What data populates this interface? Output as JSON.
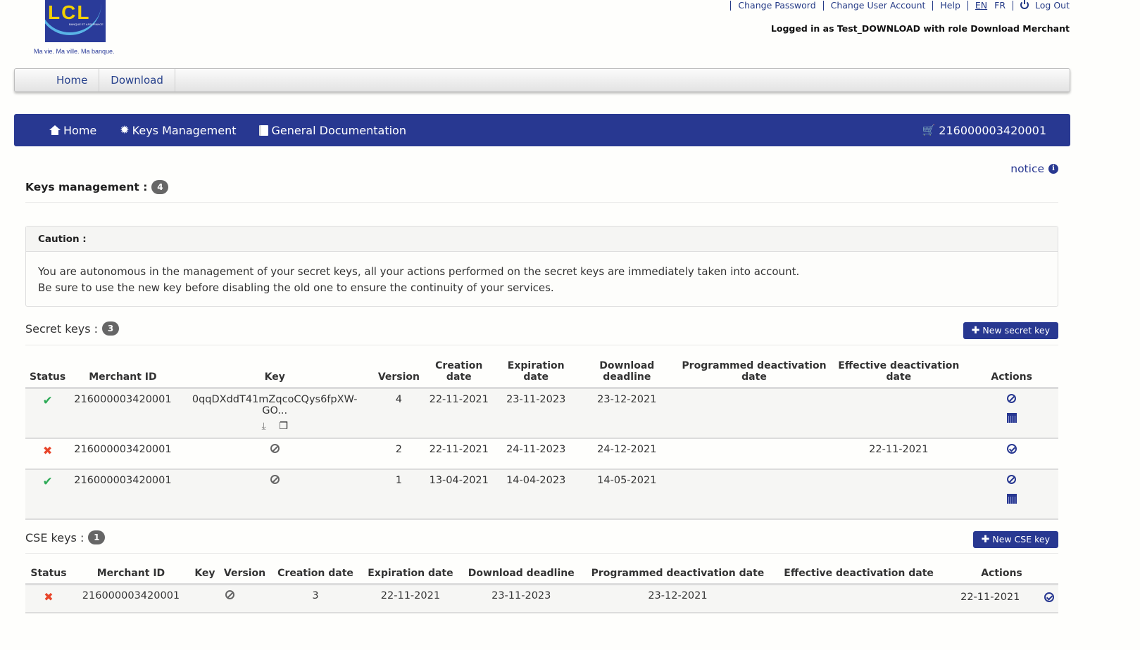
{
  "logo": {
    "brand": "LCL",
    "subtitle": "BANQUE ET ASSURANCE",
    "tagline": "Ma vie. Ma ville. Ma banque."
  },
  "toplinks": {
    "change_password": "Change Password",
    "change_user_account": "Change User Account",
    "help": "Help",
    "lang_en": "EN",
    "lang_fr": "FR",
    "logout": "Log Out"
  },
  "logged_in": "Logged in as Test_DOWNLOAD with role Download Merchant",
  "graynav": {
    "items": [
      "Home",
      "Download"
    ]
  },
  "bluenav": {
    "home": "Home",
    "keys_management": "Keys Management",
    "general_documentation": "General Documentation",
    "merchant_id": "216000003420001"
  },
  "notice": "notice",
  "page": {
    "title": "Keys management :",
    "count": "4"
  },
  "caution": {
    "title": "Caution :",
    "line1": "You are autonomous in the management of your secret keys, all your actions performed on the secret keys are immediately taken into account.",
    "line2": "Be sure to use the new key before disabling the old one to ensure the continuity of your services."
  },
  "secret_keys": {
    "title": "Secret keys :",
    "count": "3",
    "new_button": "New secret key",
    "headers": [
      "Status",
      "Merchant ID",
      "Key",
      "Version",
      "Creation date",
      "Expiration date",
      "Download deadline",
      "Programmed deactivation date",
      "Effective deactivation date",
      "Actions"
    ],
    "rows": [
      {
        "status": "active",
        "merchant_id": "216000003420001",
        "key": "0qqDXddT41mZqcoCQys6fpXW-GO...",
        "version": "4",
        "creation": "22-11-2021",
        "expiration": "23-11-2023",
        "download_deadline": "23-12-2021",
        "programmed_deactivation": "",
        "effective_deactivation": "",
        "actions": [
          "deactivate",
          "schedule"
        ]
      },
      {
        "status": "inactive",
        "merchant_id": "216000003420001",
        "key": "",
        "version": "2",
        "creation": "22-11-2021",
        "expiration": "24-11-2023",
        "download_deadline": "24-12-2021",
        "programmed_deactivation": "",
        "effective_deactivation": "22-11-2021",
        "actions": [
          "reactivate"
        ]
      },
      {
        "status": "active",
        "merchant_id": "216000003420001",
        "key": "",
        "version": "1",
        "creation": "13-04-2021",
        "expiration": "14-04-2023",
        "download_deadline": "14-05-2021",
        "programmed_deactivation": "",
        "effective_deactivation": "",
        "actions": [
          "deactivate",
          "schedule"
        ]
      }
    ]
  },
  "cse_keys": {
    "title": "CSE keys :",
    "count": "1",
    "new_button": "New CSE key",
    "headers": [
      "Status",
      "Merchant ID",
      "Key",
      "Version",
      "Creation date",
      "Expiration date",
      "Download deadline",
      "Programmed deactivation date",
      "Effective deactivation date",
      "Actions"
    ],
    "rows": [
      {
        "status": "inactive",
        "merchant_id": "216000003420001",
        "key": "",
        "version": "3",
        "creation": "22-11-2021",
        "expiration": "23-11-2023",
        "download_deadline": "23-12-2021",
        "programmed_deactivation": "",
        "effective_deactivation": "22-11-2021",
        "actions": [
          "reactivate"
        ]
      }
    ]
  },
  "colors": {
    "brand_blue": "#283891",
    "active_green": "#2eab57",
    "inactive_red": "#e8452a"
  }
}
